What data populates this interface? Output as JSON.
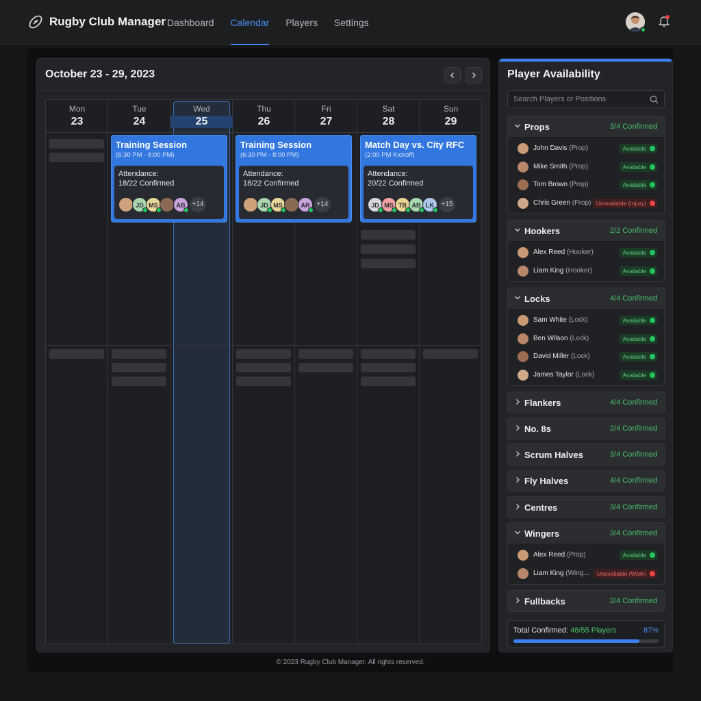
{
  "app": {
    "name": "Rugby Club Manager"
  },
  "nav": [
    {
      "label": "Dashboard",
      "active": false
    },
    {
      "label": "Calendar",
      "active": true
    },
    {
      "label": "Players",
      "active": false
    },
    {
      "label": "Settings",
      "active": false
    }
  ],
  "icons": {
    "logo": "rugby-ball-icon",
    "notifications": "bell-icon",
    "search": "search-icon",
    "prev": "chevron-left-icon",
    "next": "chevron-right-icon"
  },
  "colors": {
    "accent": "#3b82f6",
    "confirmed": "#4cc46a",
    "unavailable": "#ef4444",
    "background": "#151617"
  },
  "calendar": {
    "title": "October 23 - 29, 2023",
    "days": [
      {
        "dow": "Mon",
        "date": "23"
      },
      {
        "dow": "Tue",
        "date": "24"
      },
      {
        "dow": "Wed",
        "date": "25"
      },
      {
        "dow": "Thu",
        "date": "26"
      },
      {
        "dow": "Fri",
        "date": "27"
      },
      {
        "dow": "Sat",
        "date": "28"
      },
      {
        "dow": "Sun",
        "date": "29"
      }
    ],
    "selected_day": "Wed 25",
    "events": [
      {
        "title": "Training Session",
        "time": "(6:30 PM - 8:00 PM)",
        "attendance_label": "Attendance:",
        "attendance": "18/22 Confirmed",
        "avatars": [
          "",
          "JD",
          "MS",
          "",
          "AB"
        ],
        "more": "+14"
      },
      {
        "title": "Training Session",
        "time": "(6:30 PM - 8:00 PM)",
        "attendance_label": "Attendance:",
        "attendance": "18/22 Confirmed",
        "avatars": [
          "",
          "JD",
          "MS",
          "",
          "AR"
        ],
        "more": "+14"
      },
      {
        "title": "Match Day vs. City RFC",
        "time": "(2:00 PM Kickoff)",
        "attendance_label": "Attendance:",
        "attendance": "20/22 Confirmed",
        "avatars": [
          "JD",
          "MS",
          "TB",
          "AB",
          "LK"
        ],
        "more": "+15"
      }
    ]
  },
  "availability": {
    "title": "Player Availability",
    "search_placeholder": "Search Players or Positions",
    "groups": [
      {
        "name": "Props",
        "count": "3/4 Confirmed",
        "expanded": true,
        "players": [
          {
            "name": "John Davis",
            "pos": "(Prop)",
            "status": "Available",
            "ok": true
          },
          {
            "name": "Mike Smith",
            "pos": "(Prop)",
            "status": "Available",
            "ok": true
          },
          {
            "name": "Tom Brown",
            "pos": "(Prop)",
            "status": "Available",
            "ok": true
          },
          {
            "name": "Chris Green",
            "pos": "(Prop)",
            "status": "Unavailable (Injury)",
            "ok": false
          }
        ]
      },
      {
        "name": "Hookers",
        "count": "2/2 Confirmed",
        "expanded": true,
        "players": [
          {
            "name": "Alex Reed",
            "pos": "(Hooker)",
            "status": "Available",
            "ok": true
          },
          {
            "name": "Liam King",
            "pos": "(Hooker)",
            "status": "Available",
            "ok": true
          }
        ]
      },
      {
        "name": "Locks",
        "count": "4/4 Confirmed",
        "expanded": true,
        "players": [
          {
            "name": "Sam White",
            "pos": "(Lock)",
            "status": "Available",
            "ok": true
          },
          {
            "name": "Ben Wilson",
            "pos": "(Lock)",
            "status": "Available",
            "ok": true
          },
          {
            "name": "David Miller",
            "pos": "(Lock)",
            "status": "Available",
            "ok": true
          },
          {
            "name": "James Taylor",
            "pos": "(Lock)",
            "status": "Available",
            "ok": true
          }
        ]
      },
      {
        "name": "Flankers",
        "count": "4/4 Confirmed",
        "expanded": false,
        "players": []
      },
      {
        "name": "No. 8s",
        "count": "2/4 Confirmed",
        "expanded": false,
        "players": []
      },
      {
        "name": "Scrum Halves",
        "count": "3/4 Confirmed",
        "expanded": false,
        "players": []
      },
      {
        "name": "Fly Halves",
        "count": "4/4 Confirmed",
        "expanded": false,
        "players": []
      },
      {
        "name": "Centres",
        "count": "3/4 Confirmed",
        "expanded": false,
        "players": []
      },
      {
        "name": "Wingers",
        "count": "3/4 Confirmed",
        "expanded": true,
        "players": [
          {
            "name": "Alex Reed",
            "pos": "(Prop)",
            "status": "Available",
            "ok": true
          },
          {
            "name": "Liam King",
            "pos": "(Wing...",
            "status": "Unavailable (Work)",
            "ok": false
          }
        ]
      },
      {
        "name": "Fullbacks",
        "count": "2/4 Confirmed",
        "expanded": false,
        "players": []
      }
    ],
    "total_label": "Total Confirmed:",
    "total_value": "48/55 Players",
    "total_pct": "87%",
    "total_fraction": 0.87
  },
  "footer": "© 2023 Rugby Club Manager. All rights reserved."
}
